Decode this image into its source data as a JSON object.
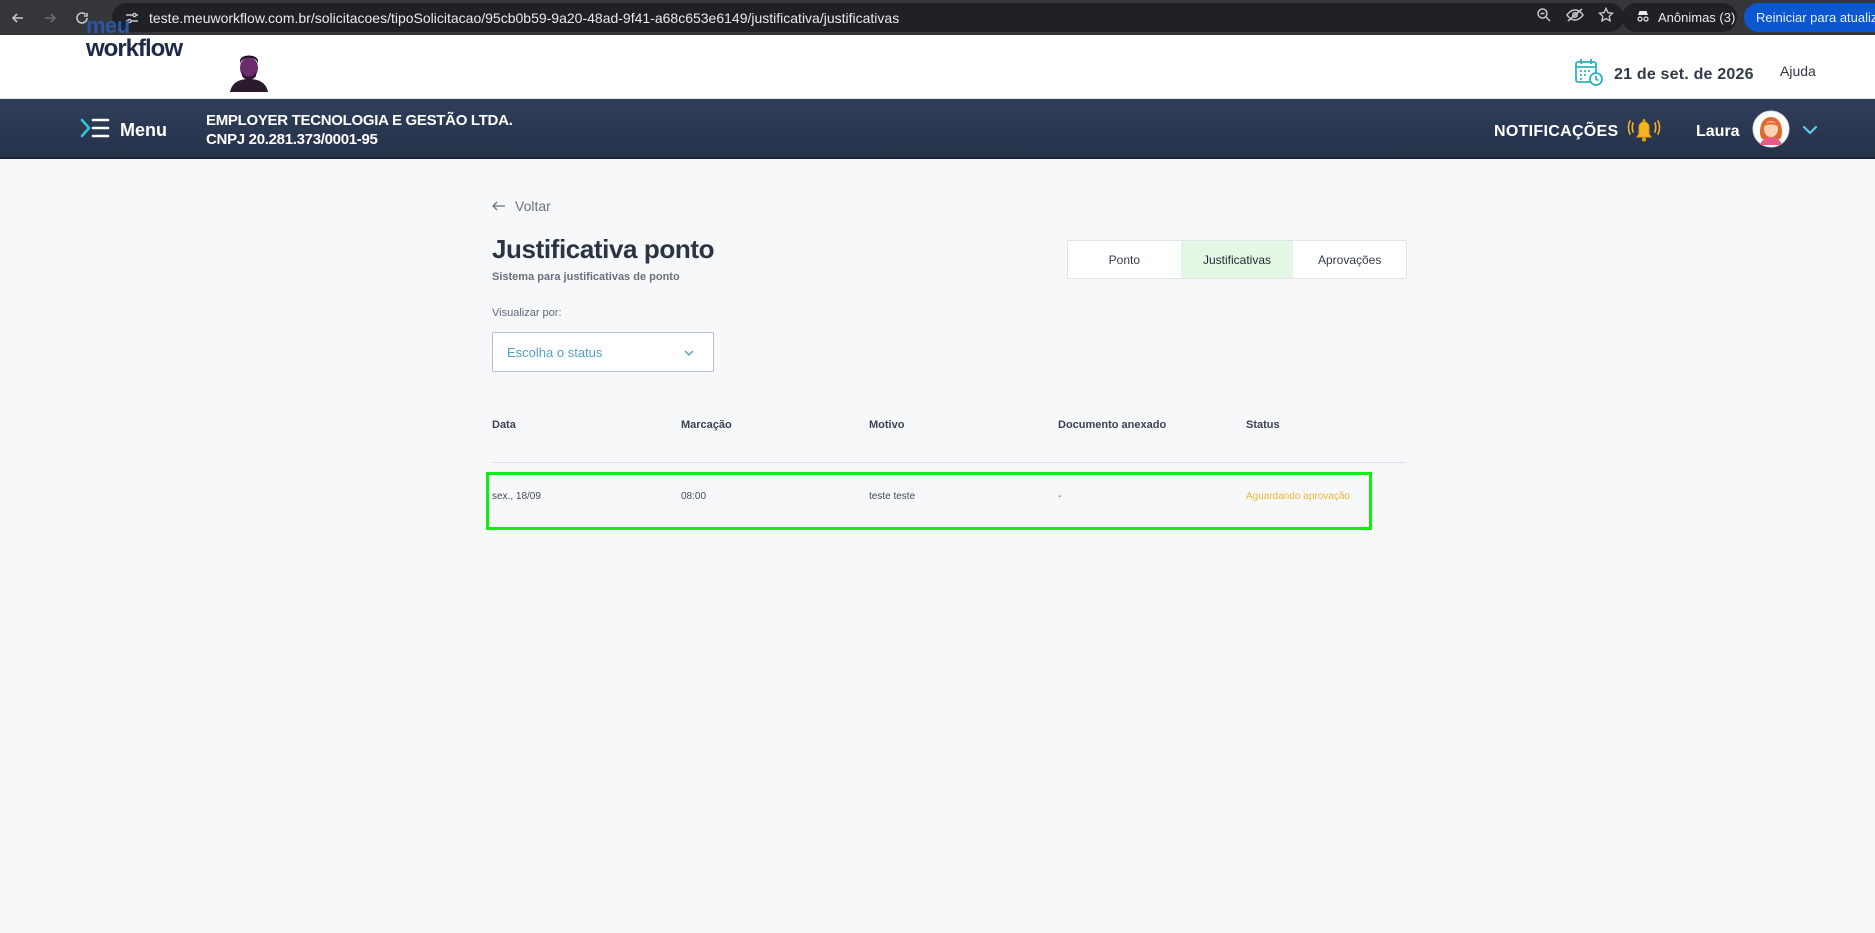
{
  "browser": {
    "url": "teste.meuworkflow.com.br/solicitacoes/tipoSolicitacao/95cb0b59-9a20-48ad-9f41-a68c653e6149/justificativa/justificativas",
    "incognito_label": "Anônimas (3)",
    "restart_label": "Reiniciar para atualizar"
  },
  "header": {
    "logo_line1": "meu",
    "logo_line2": "workflow",
    "date": "21 de set. de 2026",
    "help_label": "Ajuda"
  },
  "navbar": {
    "menu_label": "Menu",
    "company_name": "EMPLOYER TECNOLOGIA E GESTÃO LTDA.",
    "company_cnpj": "CNPJ 20.281.373/0001-95",
    "notifications_label": "NOTIFICAÇÕES",
    "user_name": "Laura"
  },
  "page": {
    "back_label": "Voltar",
    "title": "Justificativa ponto",
    "subtitle": "Sistema para justificativas de ponto",
    "tabs": [
      {
        "label": "Ponto",
        "active": false
      },
      {
        "label": "Justificativas",
        "active": true
      },
      {
        "label": "Aprovações",
        "active": false
      }
    ],
    "view_by_label": "Visualizar por:",
    "status_select_placeholder": "Escolha o status"
  },
  "table": {
    "columns": [
      "Data",
      "Marcação",
      "Motivo",
      "Documento anexado",
      "Status"
    ],
    "rows": [
      {
        "data": "sex., 18/09",
        "marcacao": "08:00",
        "motivo": "teste teste",
        "documento": "-",
        "status": "Aguardando aprovação"
      }
    ]
  },
  "colors": {
    "navbar": "#2f3e5a",
    "active_tab": "#e4f7e4",
    "status_pending": "#f2b634",
    "highlight": "#11ee11"
  }
}
